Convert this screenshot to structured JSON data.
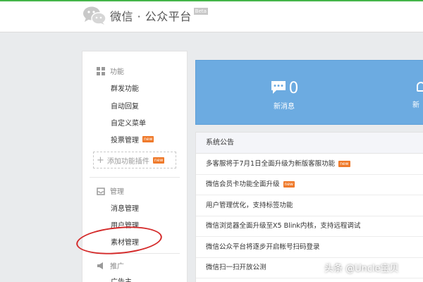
{
  "header": {
    "brand": "微信 · 公众平台",
    "badge": "Beta",
    "accent_color": "#44b549"
  },
  "sidebar": {
    "sections": [
      {
        "label": "功能",
        "icon": "grid-icon"
      },
      {
        "label": "管理",
        "icon": "inbox-icon"
      },
      {
        "label": "推广",
        "icon": "megaphone-icon"
      }
    ],
    "feature_items": [
      {
        "label": "群发功能"
      },
      {
        "label": "自动回复"
      },
      {
        "label": "自定义菜单"
      },
      {
        "label": "投票管理",
        "badge": "new"
      }
    ],
    "add_plugin": {
      "label": "添加功能插件",
      "badge": "new"
    },
    "manage_items": [
      {
        "label": "消息管理"
      },
      {
        "label": "用户管理"
      },
      {
        "label": "素材管理",
        "highlighted": true
      }
    ],
    "promo_items": [
      {
        "label": "广告主"
      }
    ],
    "highlight_color": "#d42a2a",
    "badge_color": "#ef7a2b"
  },
  "stats": {
    "new_messages": {
      "value": "0",
      "label": "新消息",
      "icon": "chat-bubble-icon"
    },
    "partial_label": "新",
    "panel_color": "#6cabe1"
  },
  "notices": {
    "title": "系统公告",
    "items": [
      {
        "text": "多客服将于7月1日全面升级为新版客服功能",
        "badge": "new"
      },
      {
        "text": "微信会员卡功能全面升级",
        "badge": "new"
      },
      {
        "text": "用户管理优化，支持标签功能"
      },
      {
        "text": "微信浏览器全面升级至X5 Blink内核，支持远程调试"
      },
      {
        "text": "微信公众平台将逐步开启帐号扫码登录"
      },
      {
        "text": "微信扫一扫开放公测"
      }
    ]
  },
  "watermark": "头条 @Uncle宝贝"
}
